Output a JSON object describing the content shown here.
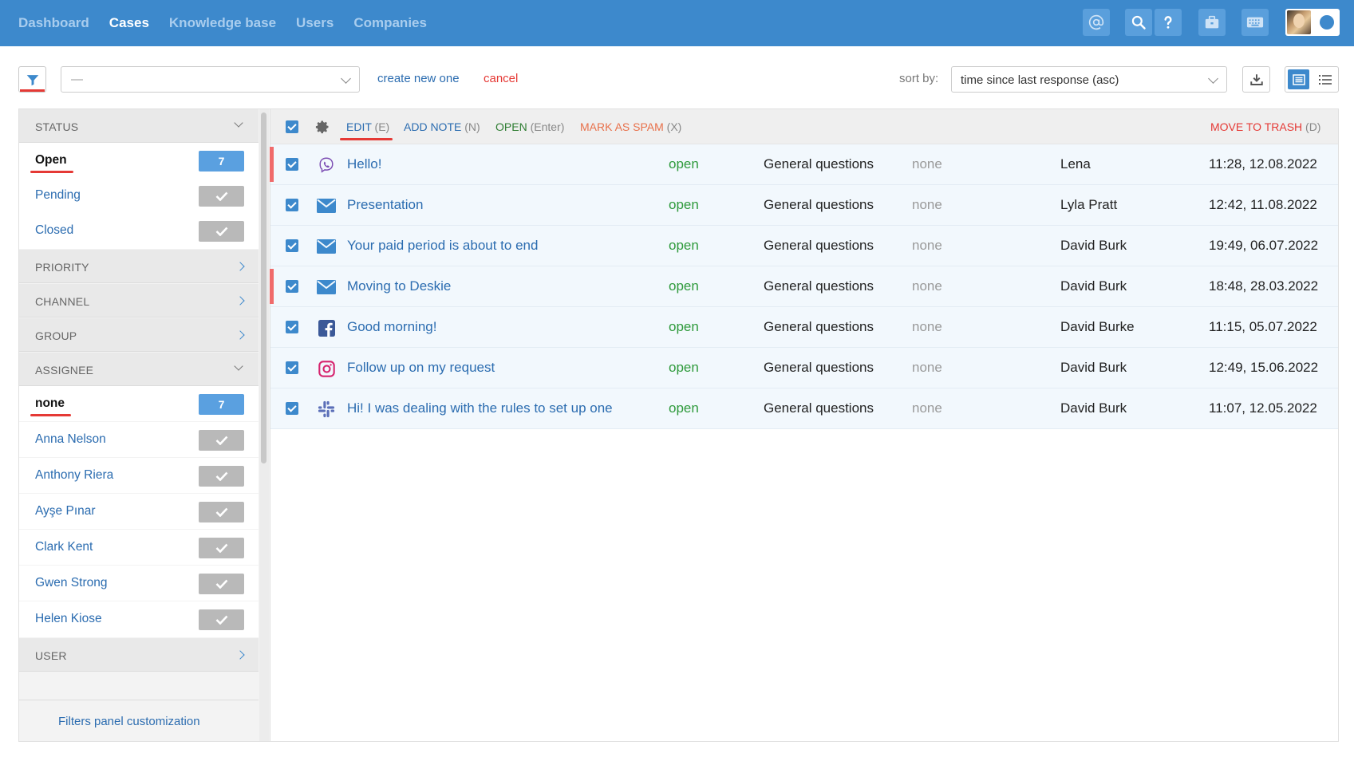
{
  "nav": {
    "items": [
      "Dashboard",
      "Cases",
      "Knowledge base",
      "Users",
      "Companies"
    ],
    "active": "Cases"
  },
  "toolbar": {
    "preset_value": "—",
    "create_new": "create new one",
    "cancel": "cancel",
    "sort_label": "sort by:",
    "sort_value": "time since last response (asc)"
  },
  "filters": {
    "status": {
      "title": "STATUS",
      "items": [
        {
          "label": "Open",
          "badge": "7",
          "selected": true
        },
        {
          "label": "Pending"
        },
        {
          "label": "Closed"
        }
      ]
    },
    "priority": {
      "title": "PRIORITY"
    },
    "channel": {
      "title": "CHANNEL"
    },
    "group": {
      "title": "GROUP"
    },
    "assignee": {
      "title": "ASSIGNEE",
      "items": [
        {
          "label": "none",
          "badge": "7",
          "selected": true
        },
        {
          "label": "Anna Nelson"
        },
        {
          "label": "Anthony Riera"
        },
        {
          "label": "Ayşe Pınar"
        },
        {
          "label": "Clark Kent"
        },
        {
          "label": "Gwen Strong"
        },
        {
          "label": "Helen Kiose"
        }
      ]
    },
    "user": {
      "title": "USER"
    },
    "customization": "Filters panel customization"
  },
  "actions": {
    "edit": "EDIT",
    "edit_key": "(E)",
    "add_note": "ADD NOTE",
    "add_note_key": "(N)",
    "open": "OPEN",
    "open_key": "(Enter)",
    "spam": "MARK AS SPAM",
    "spam_key": "(X)",
    "trash": "MOVE TO TRASH",
    "trash_key": "(D)"
  },
  "colors": {
    "primary": "#3d89cc",
    "danger": "#e53935",
    "success": "#2e9a3b",
    "spam": "#e8704a"
  },
  "cases": [
    {
      "channel": "viber-icon",
      "subject": "Hello!",
      "status": "open",
      "group": "General questions",
      "priority": "none",
      "user": "Lena",
      "date": "11:28, 12.08.2022",
      "flag": true
    },
    {
      "channel": "email-icon",
      "subject": "Presentation",
      "status": "open",
      "group": "General questions",
      "priority": "none",
      "user": "Lyla Pratt",
      "date": "12:42, 11.08.2022",
      "flag": false
    },
    {
      "channel": "email-icon",
      "subject": "Your paid period is about to end",
      "status": "open",
      "group": "General questions",
      "priority": "none",
      "user": "David Burk",
      "date": "19:49, 06.07.2022",
      "flag": false
    },
    {
      "channel": "email-icon",
      "subject": "Moving to Deskie",
      "status": "open",
      "group": "General questions",
      "priority": "none",
      "user": "David Burk",
      "date": "18:48, 28.03.2022",
      "flag": true
    },
    {
      "channel": "facebook-icon",
      "subject": "Good morning!",
      "status": "open",
      "group": "General questions",
      "priority": "none",
      "user": "David Burke",
      "date": "11:15, 05.07.2022",
      "flag": false
    },
    {
      "channel": "instagram-icon",
      "subject": "Follow up on my request",
      "status": "open",
      "group": "General questions",
      "priority": "none",
      "user": "David Burk",
      "date": "12:49, 15.06.2022",
      "flag": false
    },
    {
      "channel": "slack-icon",
      "subject": "Hi! I was dealing with the rules to set up one",
      "status": "open",
      "group": "General questions",
      "priority": "none",
      "user": "David Burk",
      "date": "11:07, 12.05.2022",
      "flag": false
    }
  ]
}
